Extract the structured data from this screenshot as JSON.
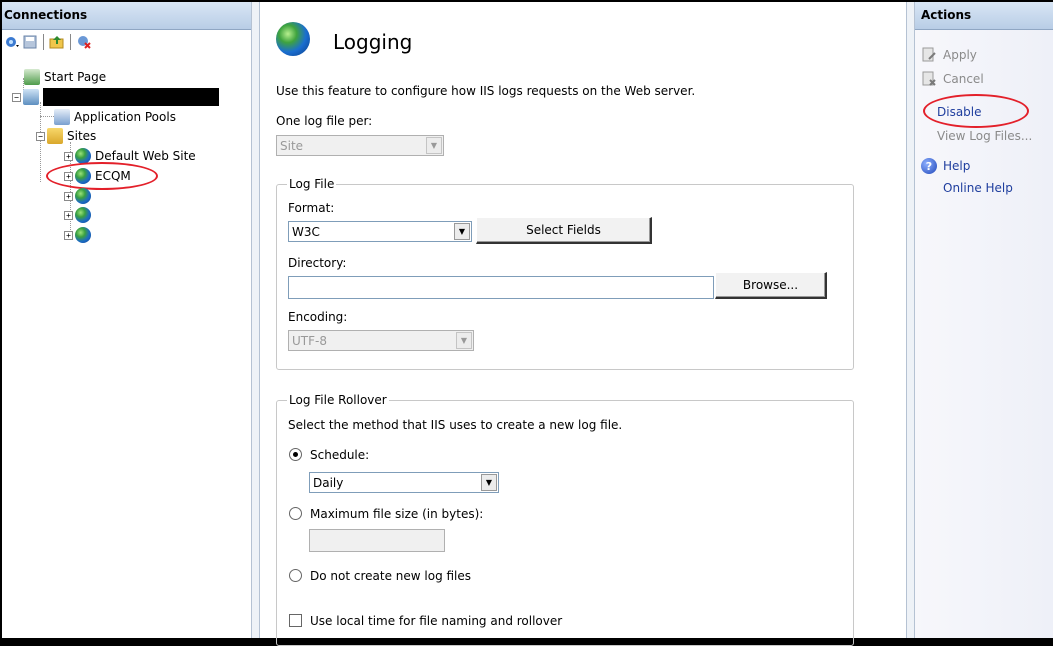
{
  "connections": {
    "header": "Connections",
    "toolbar": [
      "connect-icon",
      "save-icon",
      "up-folder-icon",
      "disconnect-icon"
    ],
    "tree": {
      "start_page": "Start Page",
      "server_name": "",
      "app_pools": "Application Pools",
      "sites": "Sites",
      "default_site": "Default Web Site",
      "ecqm": "ECQM"
    }
  },
  "main": {
    "title": "Logging",
    "description": "Use this feature to configure how IIS logs requests on the Web server.",
    "one_log_label": "One log file per:",
    "one_log_value": "Site",
    "log_file_group": "Log File",
    "format_label": "Format:",
    "format_value": "W3C",
    "select_fields": "Select Fields",
    "directory_label": "Directory:",
    "directory_value": "",
    "browse": "Browse...",
    "encoding_label": "Encoding:",
    "encoding_value": "UTF-8",
    "rollover_group": "Log File Rollover",
    "rollover_desc": "Select the method that IIS uses to create a new log file.",
    "schedule_label": "Schedule:",
    "schedule_value": "Daily",
    "max_size_label": "Maximum file size (in bytes):",
    "max_size_value": "",
    "no_new_label": "Do not create new log files",
    "local_time_label": "Use local time for file naming and rollover"
  },
  "actions": {
    "header": "Actions",
    "apply": "Apply",
    "cancel": "Cancel",
    "disable": "Disable",
    "view_logs": "View Log Files...",
    "help": "Help",
    "online_help": "Online Help"
  },
  "colors": {
    "annotation_red": "#e3202a",
    "link_blue": "#1f3e9e",
    "header_blue": "#c6d7ec"
  }
}
